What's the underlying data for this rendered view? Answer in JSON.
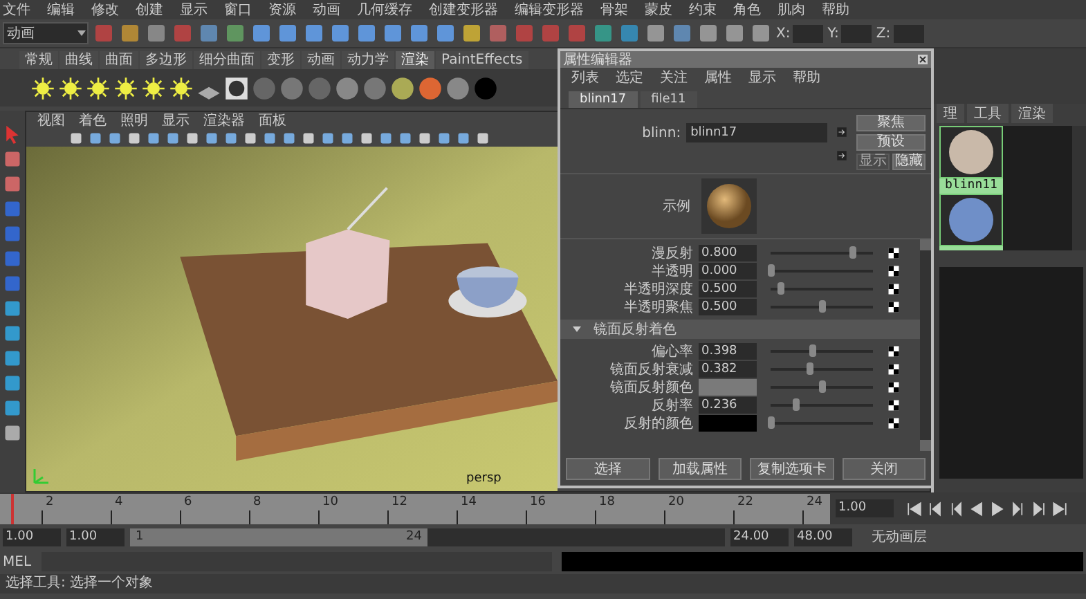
{
  "menu_bar": [
    "文件",
    "编辑",
    "修改",
    "创建",
    "显示",
    "窗口",
    "资源",
    "动画",
    "几何缓存",
    "创建变形器",
    "编辑变形器",
    "骨架",
    "蒙皮",
    "约束",
    "角色",
    "肌肉",
    "帮助"
  ],
  "toolbar": {
    "mode": "动画",
    "coords": [
      "X:",
      "Y:",
      "Z:"
    ]
  },
  "shelf": {
    "tabs": [
      {
        "label": "常规",
        "selected": false
      },
      {
        "label": "曲线",
        "selected": false
      },
      {
        "label": "曲面",
        "selected": false
      },
      {
        "label": "多边形",
        "selected": false
      },
      {
        "label": "细分曲面",
        "selected": false
      },
      {
        "label": "变形",
        "selected": false
      },
      {
        "label": "动画",
        "selected": false
      },
      {
        "label": "动力学",
        "selected": false
      },
      {
        "label": "渲染",
        "selected": true
      },
      {
        "label": "PaintEffects",
        "selected": false
      }
    ]
  },
  "viewport": {
    "menu": [
      "视图",
      "着色",
      "照明",
      "显示",
      "渲染器",
      "面板"
    ],
    "camera_label": "persp"
  },
  "attribute_editor": {
    "title": "属性编辑器",
    "menu": [
      "列表",
      "选定",
      "关注",
      "属性",
      "显示",
      "帮助"
    ],
    "tabs": [
      {
        "label": "blinn17",
        "selected": true
      },
      {
        "label": "file11",
        "selected": false
      }
    ],
    "node_label": "blinn:",
    "node_name": "blinn17",
    "side_buttons": [
      {
        "label": "聚焦",
        "disabled": false
      },
      {
        "label": "预设",
        "disabled": false
      },
      {
        "label": "显示",
        "disabled": true
      },
      {
        "label": "隐藏",
        "disabled": false
      }
    ],
    "sample_label": "示例",
    "attributes": [
      {
        "kind": "number",
        "label": "漫反射",
        "value": "0.800",
        "level": 0.8
      },
      {
        "kind": "number",
        "label": "半透明",
        "value": "0.000",
        "level": 0.0
      },
      {
        "kind": "number",
        "label": "半透明深度",
        "value": "0.500",
        "level": 0.1
      },
      {
        "kind": "number",
        "label": "半透明聚焦",
        "value": "0.500",
        "level": 0.5
      }
    ],
    "section": {
      "title": "镜面反射着色",
      "expanded": true,
      "attributes": [
        {
          "kind": "number",
          "label": "偏心率",
          "value": "0.398",
          "level": 0.4
        },
        {
          "kind": "number",
          "label": "镜面反射衰减",
          "value": "0.382",
          "level": 0.38
        },
        {
          "kind": "color",
          "label": "镜面反射颜色",
          "color": "#7a7a7a",
          "level": 0.5
        },
        {
          "kind": "number",
          "label": "反射率",
          "value": "0.236",
          "level": 0.24
        },
        {
          "kind": "color",
          "label": "反射的颜色",
          "color": "#000000",
          "level": 0.0
        }
      ]
    },
    "buttons": [
      "选择",
      "加载属性",
      "复制选项卡",
      "关闭"
    ]
  },
  "hypershade": {
    "tabs": [
      "理",
      "工具",
      "渲染"
    ],
    "swatches": [
      {
        "kind": "labeled",
        "label": "blinn11"
      },
      {
        "kind": "plain"
      }
    ]
  },
  "timeline": {
    "ticks": [
      "2",
      "4",
      "6",
      "8",
      "10",
      "12",
      "14",
      "16",
      "18",
      "20",
      "22",
      "24"
    ],
    "current_frame": "1.00",
    "level": 0
  },
  "range": {
    "start": "1.00",
    "playback_start": "1.00",
    "slider_start": "1",
    "slider_end": "24",
    "level": 0.5,
    "playback_end": "24.00",
    "end": "48.00",
    "anim_layer": "无动画层"
  },
  "command_line": {
    "label": "MEL"
  },
  "status": "选择工具: 选择一个对象"
}
